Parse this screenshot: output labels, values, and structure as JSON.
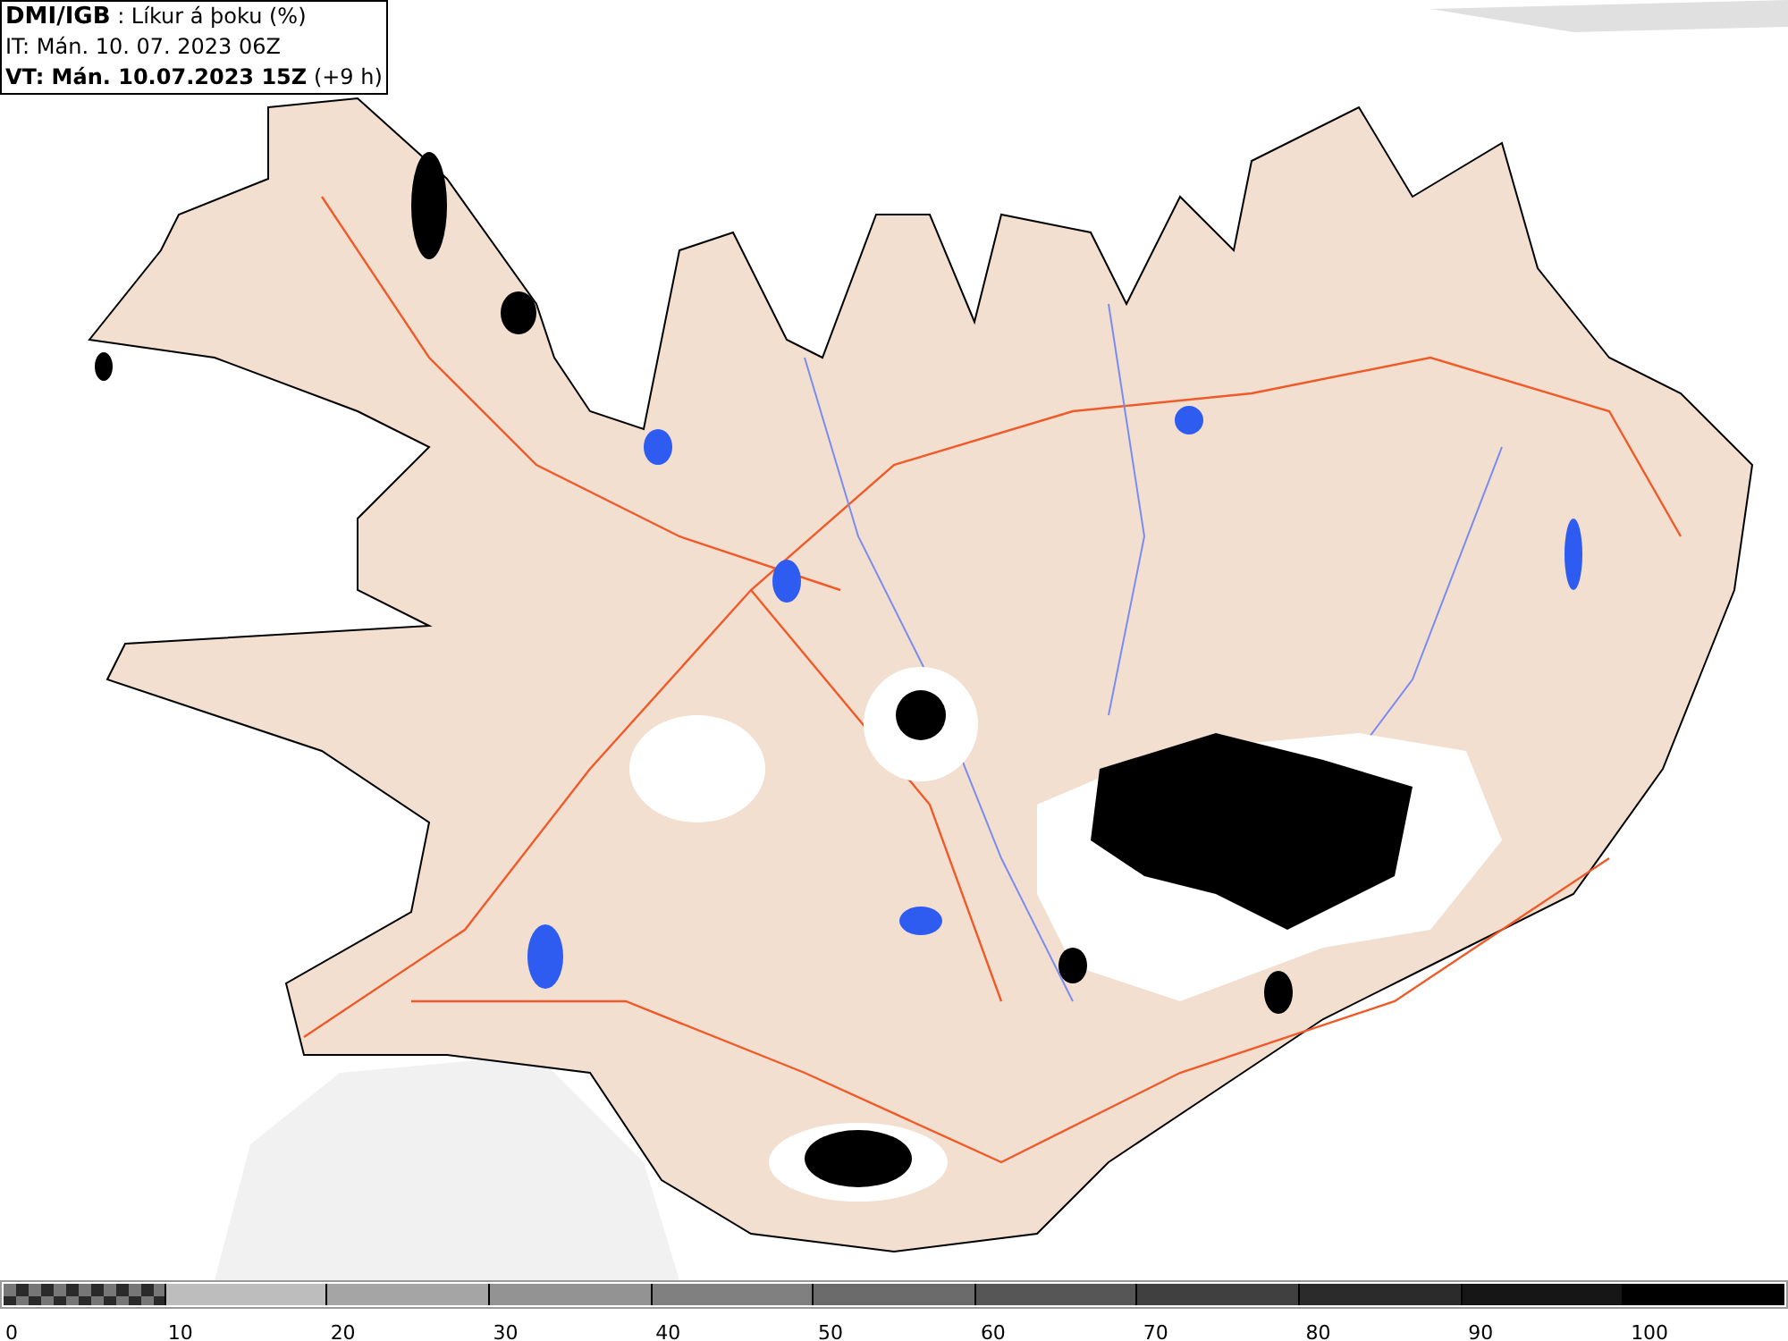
{
  "header": {
    "source": "DMI/IGB",
    "title": ": Líkur á þoku (%)",
    "issue_time": "IT: Mán. 10. 07. 2023 06Z",
    "valid_time": "VT: Mán. 10.07.2023 15Z",
    "offset": "(+9 h)"
  },
  "legend": [
    {
      "label": "0",
      "kind": "checker"
    },
    {
      "label": "10",
      "kind": "solid",
      "color": "#bdbdbd"
    },
    {
      "label": "20",
      "kind": "solid",
      "color": "#a5a5a5"
    },
    {
      "label": "30",
      "kind": "solid",
      "color": "#939393"
    },
    {
      "label": "40",
      "kind": "solid",
      "color": "#808080"
    },
    {
      "label": "50",
      "kind": "solid",
      "color": "#6b6b6b"
    },
    {
      "label": "60",
      "kind": "solid",
      "color": "#565656"
    },
    {
      "label": "70",
      "kind": "solid",
      "color": "#404040"
    },
    {
      "label": "80",
      "kind": "solid",
      "color": "#2b2b2b"
    },
    {
      "label": "90",
      "kind": "solid",
      "color": "#161616"
    },
    {
      "label": "100",
      "kind": "solid",
      "color": "#000000"
    }
  ]
}
